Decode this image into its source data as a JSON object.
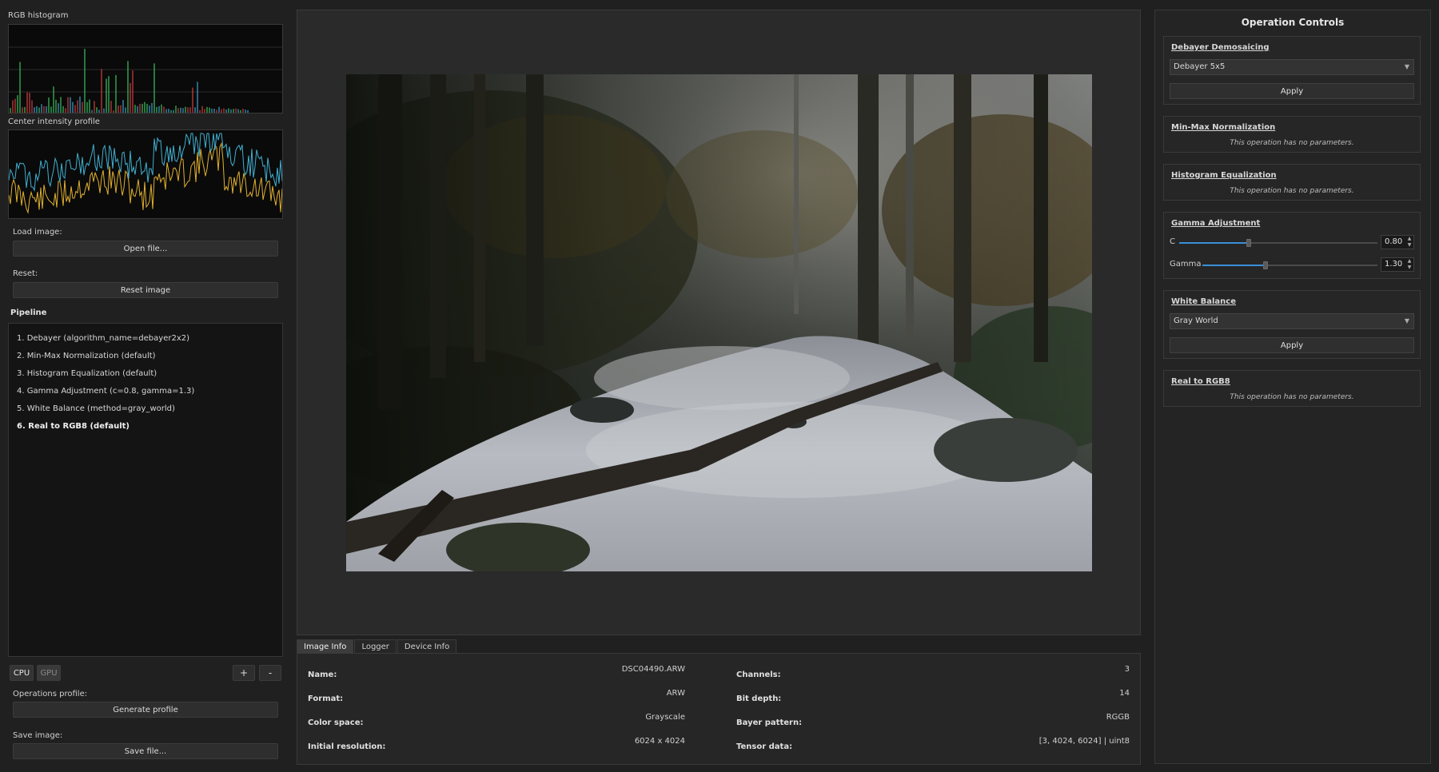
{
  "left": {
    "histogram_label": "RGB histogram",
    "profile_label": "Center intensity profile",
    "load_label": "Load image:",
    "open_button": "Open file...",
    "reset_label": "Reset:",
    "reset_button": "Reset image",
    "pipeline_title": "Pipeline",
    "pipeline": [
      "1. Debayer (algorithm_name=debayer2x2)",
      "2. Min-Max Normalization (default)",
      "3. Histogram Equalization (default)",
      "4. Gamma Adjustment (c=0.8, gamma=1.3)",
      "5. White Balance (method=gray_world)",
      "6. Real to RGB8 (default)"
    ],
    "active_pipeline_index": 5,
    "cpu_label": "CPU",
    "gpu_label": "GPU",
    "plus_label": "+",
    "minus_label": "-",
    "ops_profile_label": "Operations profile:",
    "generate_button": "Generate profile",
    "save_label": "Save image:",
    "save_button": "Save file..."
  },
  "tabs": [
    "Image Info",
    "Logger",
    "Device Info"
  ],
  "info": {
    "name_label": "Name:",
    "name_value": "DSC04490.ARW",
    "format_label": "Format:",
    "format_value": "ARW",
    "colorspace_label": "Color space:",
    "colorspace_value": "Grayscale",
    "resolution_label": "Initial resolution:",
    "resolution_value": "6024 x 4024",
    "channels_label": "Channels:",
    "channels_value": "3",
    "bitdepth_label": "Bit depth:",
    "bitdepth_value": "14",
    "bayer_label": "Bayer pattern:",
    "bayer_value": "RGGB",
    "tensor_label": "Tensor data:",
    "tensor_value": "[3, 4024, 6024] | uint8"
  },
  "right": {
    "title": "Operation Controls",
    "debayer_title": "Debayer Demosaicing",
    "debayer_select": "Debayer 5x5",
    "apply_label": "Apply",
    "minmax_title": "Min-Max Normalization",
    "no_params": "This operation has no parameters.",
    "histeq_title": "Histogram Equalization",
    "gamma_title": "Gamma Adjustment",
    "c_label": "C",
    "c_value": "0.80",
    "gamma_label": "Gamma",
    "gamma_value": "1.30",
    "wb_title": "White Balance",
    "wb_select": "Gray World",
    "rgb8_title": "Real to RGB8"
  },
  "sliders": {
    "c_fraction": 0.35,
    "gamma_fraction": 0.36
  },
  "colors": {
    "accent": "#3a8fd6",
    "panel": "#262626",
    "background": "#202020"
  }
}
